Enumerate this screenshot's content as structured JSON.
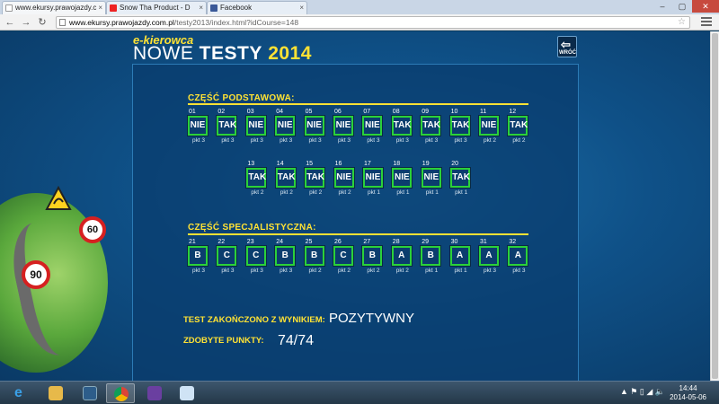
{
  "browser": {
    "tabs": [
      {
        "label": "www.ekursy.prawojazdy.c",
        "icon": "page-icon"
      },
      {
        "label": "Snow Tha Product - D",
        "icon": "youtube-icon"
      },
      {
        "label": "Facebook",
        "icon": "facebook-icon"
      }
    ],
    "url_host": "www.ekursy.prawojazdy.com.pl",
    "url_path": "/testy2013/index.html?idCourse=148"
  },
  "header": {
    "brand_small": "e-kierowca",
    "brand_word1": "NOWE",
    "brand_word2": "TESTY",
    "brand_year": "2014",
    "back_label": "WRÓĆ"
  },
  "signs": [
    "60",
    "90"
  ],
  "basic": {
    "title": "CZĘŚĆ PODSTAWOWA:",
    "items": [
      {
        "num": "01",
        "answer": "NIE",
        "points": "pkt 3"
      },
      {
        "num": "02",
        "answer": "TAK",
        "points": "pkt 3"
      },
      {
        "num": "03",
        "answer": "NIE",
        "points": "pkt 3"
      },
      {
        "num": "04",
        "answer": "NIE",
        "points": "pkt 3"
      },
      {
        "num": "05",
        "answer": "NIE",
        "points": "pkt 3"
      },
      {
        "num": "06",
        "answer": "NIE",
        "points": "pkt 3"
      },
      {
        "num": "07",
        "answer": "NIE",
        "points": "pkt 3"
      },
      {
        "num": "08",
        "answer": "TAK",
        "points": "pkt 3"
      },
      {
        "num": "09",
        "answer": "TAK",
        "points": "pkt 3"
      },
      {
        "num": "10",
        "answer": "TAK",
        "points": "pkt 3"
      },
      {
        "num": "11",
        "answer": "NIE",
        "points": "pkt 2"
      },
      {
        "num": "12",
        "answer": "TAK",
        "points": "pkt 2"
      },
      {
        "num": "13",
        "answer": "TAK",
        "points": "pkt 2"
      },
      {
        "num": "14",
        "answer": "TAK",
        "points": "pkt 2"
      },
      {
        "num": "15",
        "answer": "TAK",
        "points": "pkt 2"
      },
      {
        "num": "16",
        "answer": "NIE",
        "points": "pkt 2"
      },
      {
        "num": "17",
        "answer": "NIE",
        "points": "pkt 1"
      },
      {
        "num": "18",
        "answer": "NIE",
        "points": "pkt 1"
      },
      {
        "num": "19",
        "answer": "NIE",
        "points": "pkt 1"
      },
      {
        "num": "20",
        "answer": "TAK",
        "points": "pkt 1"
      }
    ]
  },
  "specialist": {
    "title": "CZĘŚĆ SPECJALISTYCZNA:",
    "items": [
      {
        "num": "21",
        "answer": "B",
        "points": "pkt 3"
      },
      {
        "num": "22",
        "answer": "C",
        "points": "pkt 3"
      },
      {
        "num": "23",
        "answer": "C",
        "points": "pkt 3"
      },
      {
        "num": "24",
        "answer": "B",
        "points": "pkt 3"
      },
      {
        "num": "25",
        "answer": "B",
        "points": "pkt 2"
      },
      {
        "num": "26",
        "answer": "C",
        "points": "pkt 2"
      },
      {
        "num": "27",
        "answer": "B",
        "points": "pkt 2"
      },
      {
        "num": "28",
        "answer": "A",
        "points": "pkt 2"
      },
      {
        "num": "29",
        "answer": "B",
        "points": "pkt 1"
      },
      {
        "num": "30",
        "answer": "A",
        "points": "pkt 1"
      },
      {
        "num": "31",
        "answer": "A",
        "points": "pkt 3"
      },
      {
        "num": "32",
        "answer": "A",
        "points": "pkt 3"
      }
    ]
  },
  "result": {
    "status_label": "TEST ZAKOŃCZONO Z WYNIKIEM:",
    "status_value": "POZYTYWNY",
    "points_label": "ZDOBYTE PUNKTY:",
    "points_value": "74/74"
  },
  "taskbar": {
    "time": "14:44",
    "date": "2014-05-06"
  },
  "colors": {
    "accent_yellow": "#ffe234",
    "tile_border_green": "#2bd13a",
    "page_blue": "#0f5188"
  }
}
